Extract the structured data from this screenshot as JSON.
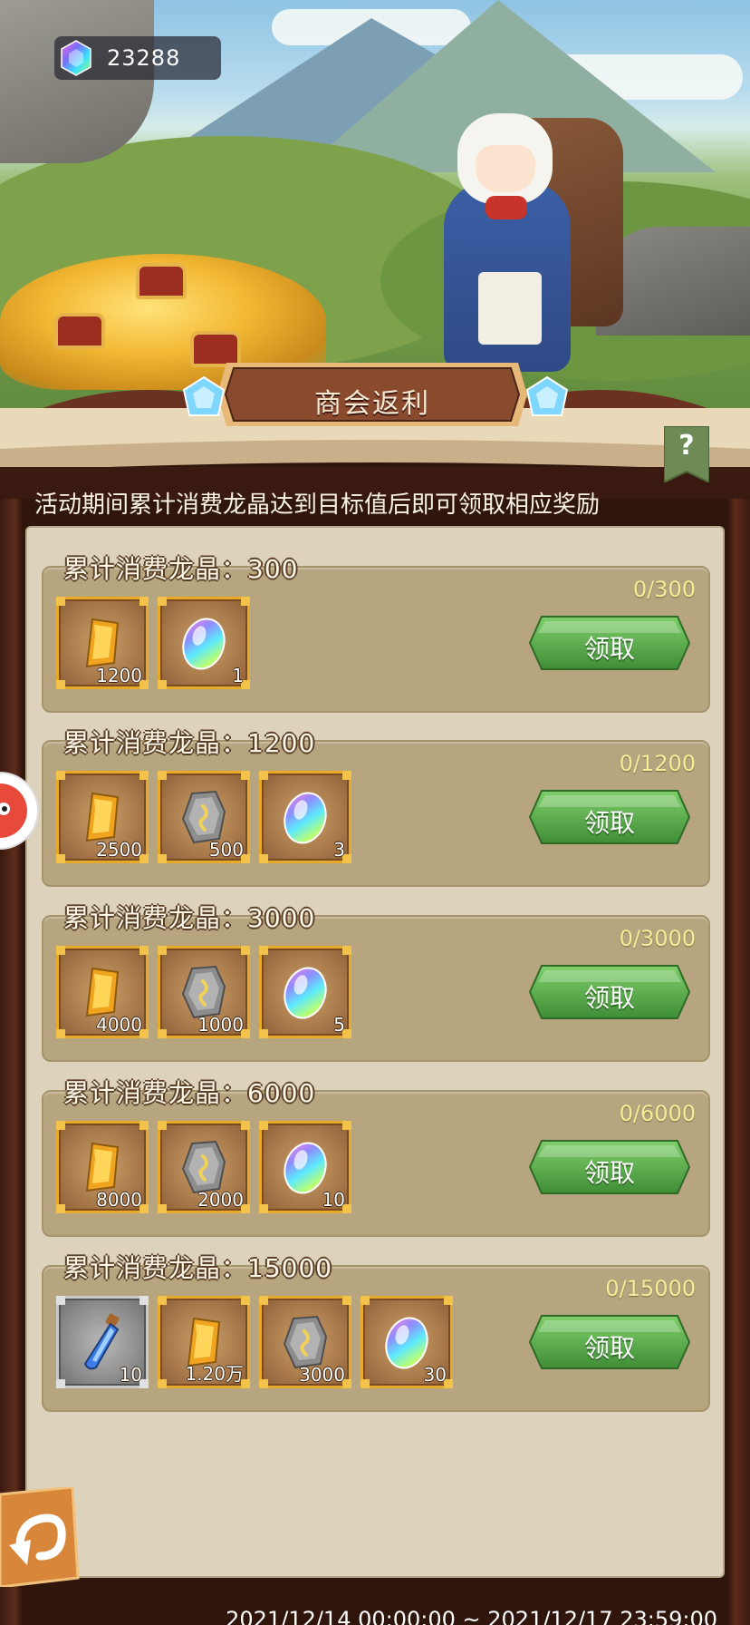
{
  "currency": {
    "icon": "dragon-crystal-icon",
    "value": "23288"
  },
  "panel": {
    "title": "商会返利",
    "help_icon": "help-question-icon",
    "description": "活动期间累计消费龙晶达到目标值后即可领取相应奖励"
  },
  "tiers": [
    {
      "title": "累计消费龙晶：300",
      "progress": "0/300",
      "claim_label": "领取",
      "rewards": [
        {
          "icon": "gold-ingot-icon",
          "qty": "1200"
        },
        {
          "icon": "rainbow-crystal-icon",
          "qty": "1"
        }
      ]
    },
    {
      "title": "累计消费龙晶：1200",
      "progress": "0/1200",
      "claim_label": "领取",
      "rewards": [
        {
          "icon": "gold-ingot-icon",
          "qty": "2500"
        },
        {
          "icon": "stone-rune-icon",
          "qty": "500"
        },
        {
          "icon": "rainbow-crystal-icon",
          "qty": "3"
        }
      ]
    },
    {
      "title": "累计消费龙晶：3000",
      "progress": "0/3000",
      "claim_label": "领取",
      "rewards": [
        {
          "icon": "gold-ingot-icon",
          "qty": "4000"
        },
        {
          "icon": "stone-rune-icon",
          "qty": "1000"
        },
        {
          "icon": "rainbow-crystal-icon",
          "qty": "5"
        }
      ]
    },
    {
      "title": "累计消费龙晶：6000",
      "progress": "0/6000",
      "claim_label": "领取",
      "rewards": [
        {
          "icon": "gold-ingot-icon",
          "qty": "8000"
        },
        {
          "icon": "stone-rune-icon",
          "qty": "2000"
        },
        {
          "icon": "rainbow-crystal-icon",
          "qty": "10"
        }
      ]
    },
    {
      "title": "累计消费龙晶：15000",
      "progress": "0/15000",
      "claim_label": "领取",
      "rewards": [
        {
          "icon": "blue-potion-icon",
          "qty": "10"
        },
        {
          "icon": "gold-ingot-icon",
          "qty": "1.20万"
        },
        {
          "icon": "stone-rune-icon",
          "qty": "3000"
        },
        {
          "icon": "rainbow-crystal-icon",
          "qty": "30"
        }
      ]
    }
  ],
  "footer": {
    "back_icon": "back-arrow-icon",
    "time_range": "2021/12/14 00:00:00 ~ 2021/12/17 23:59:00"
  },
  "side_bubble_icon": "mascot-bubble-icon"
}
